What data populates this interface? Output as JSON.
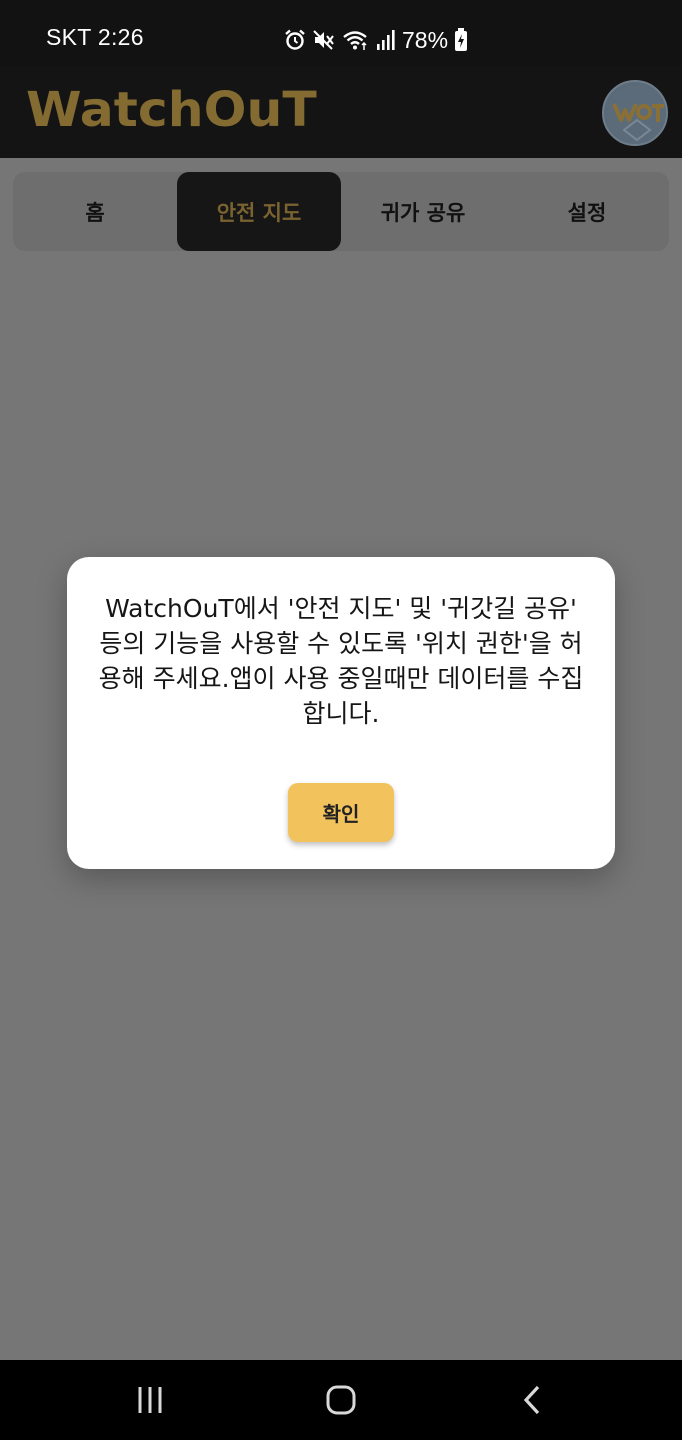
{
  "status_bar": {
    "carrier_time": "SKT 2:26",
    "battery": "78%",
    "icons": [
      "alarm-icon",
      "mute-icon",
      "wifi-icon",
      "signal-icon",
      "battery-charging-icon"
    ]
  },
  "header": {
    "logo": "WatchOuT",
    "avatar_icon": "avatar-logo-icon",
    "logo_color": "#836b31"
  },
  "tabs": [
    {
      "label": "홈",
      "active": false
    },
    {
      "label": "안전 지도",
      "active": true
    },
    {
      "label": "귀가 공유",
      "active": false
    },
    {
      "label": "설정",
      "active": false
    }
  ],
  "dialog": {
    "message": "WatchOuT에서 '안전 지도' 및 '귀갓길 공유' 등의 기능을 사용할 수 있도록 '위치 권한'을 허용해 주세요.앱이 사용 중일때만 데이터를 수집합니다.",
    "confirm_label": "확인",
    "button_color": "#f2c25d"
  },
  "nav_bar": {
    "icons": [
      "recent-apps-icon",
      "home-icon",
      "back-icon"
    ]
  }
}
